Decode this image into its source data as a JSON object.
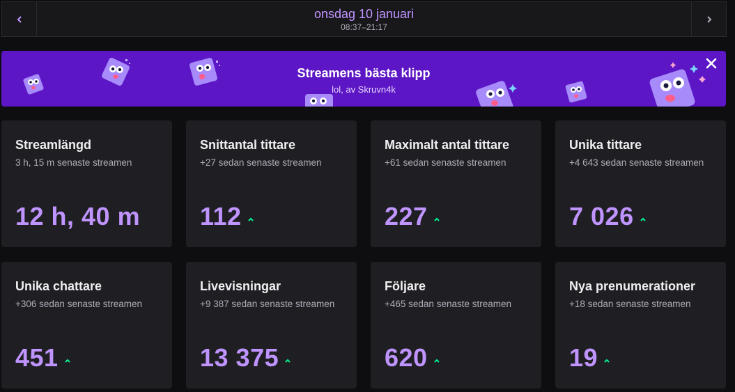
{
  "header": {
    "date": "onsdag 10 januari",
    "time_range": "08:37–21:17",
    "prev_icon": "chevron-left-icon",
    "next_icon": "chevron-right-icon"
  },
  "banner": {
    "title": "Streamens bästa klipp",
    "subtitle": "lol, av Skruvn4k",
    "close_icon": "close-icon",
    "background_color": "#5c16c5"
  },
  "stats": [
    {
      "title": "Streamlängd",
      "subtitle": "3 h, 15 m senaste streamen",
      "value": "12 h, 40 m",
      "trend": ""
    },
    {
      "title": "Snittantal tittare",
      "subtitle": "+27 sedan senaste streamen",
      "value": "112",
      "trend": "up"
    },
    {
      "title": "Maximalt antal tittare",
      "subtitle": "+61 sedan senaste streamen",
      "value": "227",
      "trend": "up"
    },
    {
      "title": "Unika tittare",
      "subtitle": "+4 643 sedan senaste streamen",
      "value": "7 026",
      "trend": "up"
    },
    {
      "title": "Unika chattare",
      "subtitle": "+306 sedan senaste streamen",
      "value": "451",
      "trend": "up"
    },
    {
      "title": "Livevisningar",
      "subtitle": "+9 387 sedan senaste streamen",
      "value": "13 375",
      "trend": "up"
    },
    {
      "title": "Följare",
      "subtitle": "+465 sedan senaste streamen",
      "value": "620",
      "trend": "up"
    },
    {
      "title": "Nya prenumerationer",
      "subtitle": "+18 sedan senaste streamen",
      "value": "19",
      "trend": "up"
    }
  ],
  "colors": {
    "accent": "#bf94ff",
    "trend_up": "#00f593",
    "card_bg": "#1f1f23",
    "page_bg": "#0e0e10"
  }
}
